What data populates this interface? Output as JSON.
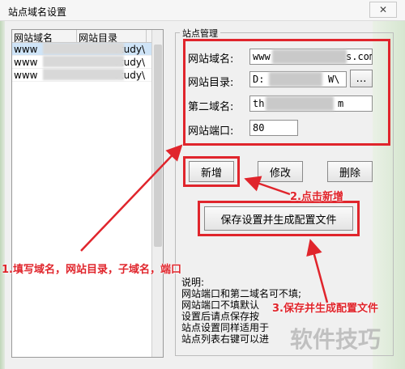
{
  "window": {
    "title": "站点域名设置",
    "close_glyph": "✕"
  },
  "site_list": {
    "columns": [
      "网站域名",
      "网站目录"
    ],
    "rows": [
      {
        "domain": "www",
        "dir": "Study\\",
        "selected": true
      },
      {
        "domain": "www",
        "dir": "Study\\",
        "selected": false
      },
      {
        "domain": "www",
        "dir": "Study\\",
        "selected": false
      }
    ]
  },
  "site_group": {
    "legend": "站点管理",
    "domain_label": "网站域名:",
    "domain_value": "www",
    "domain_value_tail": "s.com",
    "dir_label": "网站目录:",
    "dir_value": "D:",
    "dir_value_tail": "W\\",
    "browse_label": "…",
    "subdomain_label": "第二域名:",
    "subdomain_value": "th",
    "subdomain_value_tail": "m",
    "port_label": "网站端口:",
    "port_value": "80"
  },
  "buttons": {
    "add": "新增",
    "edit": "修改",
    "delete": "删除",
    "save": "保存设置并生成配置文件"
  },
  "notes": {
    "heading": "说明:",
    "lines": [
      "网站端口和第二域名可不填;",
      "网站端口不填默认",
      "设置后请点保存按",
      "站点设置同样适用于",
      "站点列表右键可以进"
    ]
  },
  "annotations": {
    "step1": "1.填写域名，网站目录，子域名，端口",
    "step2": "2.点击新增",
    "step3": "3.保存并生成配置文件",
    "accent_color": "#e0252c"
  },
  "watermark": "软件技巧"
}
